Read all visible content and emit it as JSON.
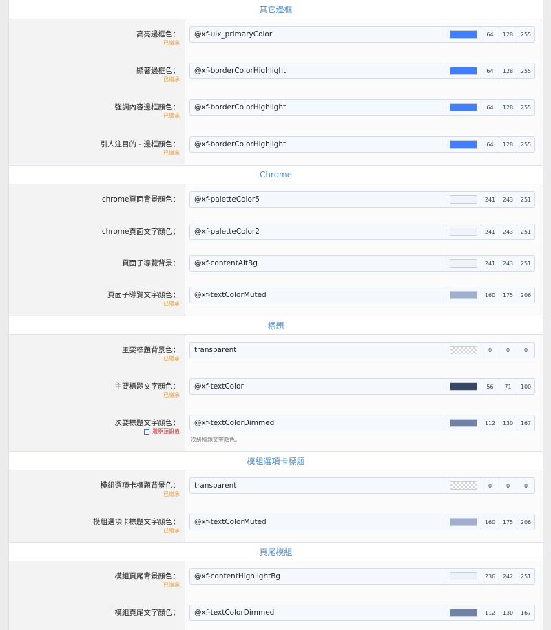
{
  "sections": {
    "other_borders": {
      "title": "其它邊框"
    },
    "chrome": {
      "title": "Chrome"
    },
    "headings": {
      "title": "標題"
    },
    "module_tabs": {
      "title": "模組選項卡標題"
    },
    "footer_module": {
      "title": "頁尾模組"
    }
  },
  "common": {
    "inherited": "已繼承",
    "revert": "還原預設值"
  },
  "rows": {
    "r1": {
      "label": "高亮邊框色：",
      "value": "@xf-uix_primaryColor",
      "color": "#4080ff",
      "r": "64",
      "g": "128",
      "b": "255"
    },
    "r2": {
      "label": "顯著邊框色：",
      "value": "@xf-borderColorHighlight",
      "color": "#4080ff",
      "r": "64",
      "g": "128",
      "b": "255"
    },
    "r3": {
      "label": "強調內容邊框顏色：",
      "value": "@xf-borderColorHighlight",
      "color": "#4080ff",
      "r": "64",
      "g": "128",
      "b": "255"
    },
    "r4": {
      "label": "引人注目的 - 邊框顏色：",
      "value": "@xf-borderColorHighlight",
      "color": "#4080ff",
      "r": "64",
      "g": "128",
      "b": "255"
    },
    "r5": {
      "label": "chrome頁面背景顏色：",
      "value": "@xf-paletteColor5",
      "color": "#f1f3fb",
      "r": "241",
      "g": "243",
      "b": "251"
    },
    "r6": {
      "label": "chrome頁面文字顏色：",
      "value": "@xf-paletteColor2",
      "color": "#f1f3fb",
      "r": "241",
      "g": "243",
      "b": "251"
    },
    "r7": {
      "label": "頁面子導覽背景：",
      "value": "@xf-contentAltBg",
      "color": "#f1f3fb",
      "r": "241",
      "g": "243",
      "b": "251"
    },
    "r8": {
      "label": "頁面子導覽文字顏色：",
      "value": "@xf-textColorMuted",
      "color": "#a0afce",
      "r": "160",
      "g": "175",
      "b": "206"
    },
    "r9": {
      "label": "主要標題背景色：",
      "value": "transparent",
      "color": "transparent",
      "r": "0",
      "g": "0",
      "b": "0"
    },
    "r10": {
      "label": "主要標題文字顏色：",
      "value": "@xf-textColor",
      "color": "#384764",
      "r": "56",
      "g": "71",
      "b": "100"
    },
    "r11": {
      "label": "次要標題文字顏色：",
      "value": "@xf-textColorDimmed",
      "color": "#7082a7",
      "r": "112",
      "g": "130",
      "b": "167",
      "hint": "次級標題文字顏色。"
    },
    "r12": {
      "label": "模組選項卡標題背景色：",
      "value": "transparent",
      "color": "transparent",
      "r": "0",
      "g": "0",
      "b": "0"
    },
    "r13": {
      "label": "模組選項卡標題文字顏色：",
      "value": "@xf-textColorMuted",
      "color": "#a0afce",
      "r": "160",
      "g": "175",
      "b": "206"
    },
    "r14": {
      "label": "模組頁尾背景顏色：",
      "value": "@xf-contentHighlightBg",
      "color": "#ecf2fb",
      "r": "236",
      "g": "242",
      "b": "251"
    },
    "r15": {
      "label": "模組頁尾文字顏色：",
      "value": "@xf-textColorDimmed",
      "color": "#7082a7",
      "r": "112",
      "g": "130",
      "b": "167"
    }
  }
}
